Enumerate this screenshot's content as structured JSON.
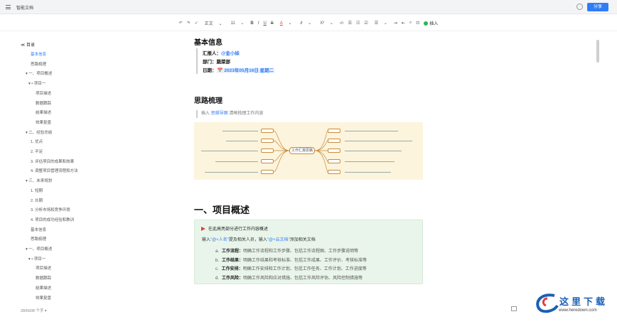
{
  "titlebar": {
    "doc_title": "智能文档",
    "share_label": "分享"
  },
  "toolbar": {
    "undo": "↶",
    "redo": "↷",
    "format_painter": "✓",
    "paragraph": "正文",
    "para_caret": "⌄",
    "font_size": "11",
    "size_caret": "⌄",
    "bold": "B",
    "italic": "I",
    "underline": "U",
    "strike": "S",
    "font_color": "A",
    "color_caret": "⌄",
    "highlight": "∂",
    "hl_caret": "⌄",
    "superscript": "X²",
    "sup_caret": "⌄",
    "code": "‹/›",
    "ul": "☰",
    "ol": "☷",
    "checkbox": "☑",
    "align": "☰",
    "align_caret": "⌄",
    "indent": "⇥",
    "outdent": "⇤",
    "search": "⌕",
    "comment": "⊡",
    "insert": "插入"
  },
  "toc": {
    "heading": "≪ 目录",
    "items": [
      {
        "label": "基本信息",
        "active": true
      },
      {
        "label": "思路梳理"
      },
      {
        "label": "▾ 一、项目概述"
      },
      {
        "label": "▾ • 项目一"
      },
      {
        "label": "项目描述"
      },
      {
        "label": "数据跟踪"
      },
      {
        "label": "结果描述"
      },
      {
        "label": "效果复盘"
      },
      {
        "label": "▾ 二、经验总结"
      },
      {
        "label": "1. 优点"
      },
      {
        "label": "2. 不足"
      },
      {
        "label": "3. 评估项目的成果和效果"
      },
      {
        "label": "4. 调整项目管理流程和方法"
      },
      {
        "label": "▾ 三、未来规划"
      },
      {
        "label": "1. 短期"
      },
      {
        "label": "2. 长期"
      },
      {
        "label": "3. 分析市场和竞争环境"
      },
      {
        "label": "4. 项目的成功经验和教训"
      },
      {
        "label": "基本信息"
      },
      {
        "label": "思路梳理"
      },
      {
        "label": "▾ 一、项目概述"
      },
      {
        "label": "▾ • 项目一"
      },
      {
        "label": "项目描述"
      },
      {
        "label": "数据跟踪"
      },
      {
        "label": "结果描述"
      },
      {
        "label": "效果复盘"
      }
    ],
    "word_count": "28/6608 个字 ▾"
  },
  "content": {
    "section1_title": "基本信息",
    "reporter_label": "汇报人：",
    "reporter_value": "@金小妹",
    "dept_label": "部门：",
    "dept_value": "蔬菜部",
    "date_label": "日期：",
    "date_value": "📅 2023年05月16日 星期二",
    "section2_title": "思路梳理",
    "tip_prefix": "插入",
    "tip_link": "思维导图",
    "tip_suffix": "清晰梳理工作内容",
    "mindmap_center": "工作汇报思路",
    "section3_title": "一、项目概述",
    "callout_title": "在此高亮部分进行工作内容概述",
    "callout_line_prefix": "输入",
    "callout_mention1": "\"@+人名\"",
    "callout_line_mid": "提及相关人员，输入",
    "callout_mention2": "\"@+云文档\"",
    "callout_line_suffix": "添加相关文档",
    "list": [
      {
        "marker": "a.",
        "label": "工作流程：",
        "text": "明确工作流程和工作步骤、包括工作流程图、工作步骤说明等"
      },
      {
        "marker": "b.",
        "label": "工作结果：",
        "text": "明确工作结果和考核标准、包括工作成果、工作评价、考核标准等"
      },
      {
        "marker": "c.",
        "label": "工作安排：",
        "text": "明确工作安排和工作计划、包括工作任务、工作计划、工作进度等"
      },
      {
        "marker": "d.",
        "label": "工作风险：",
        "text": "明确工作风险和应对措施、包括工作风险评估、风险控制措施等"
      }
    ]
  },
  "watermark": {
    "text": "这里下载",
    "url": "www.heredown.com"
  },
  "colors": {
    "accent": "#2f7cf6",
    "callout_bg": "#e9f5ea",
    "mindmap_bg": "#fcf4dc"
  }
}
